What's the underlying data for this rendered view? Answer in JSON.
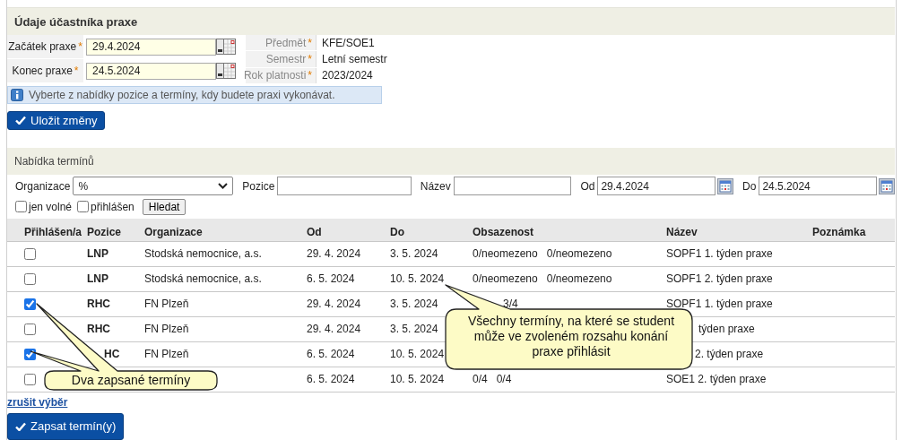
{
  "participant": {
    "title": "Údaje účastníka praxe",
    "dates": [
      {
        "label": "Začátek praxe",
        "required_mark": "*",
        "value": "29.4.2024"
      },
      {
        "label": "Konec praxe",
        "required_mark": "*",
        "value": "24.5.2024"
      }
    ],
    "details": [
      {
        "label": "Předmět",
        "required_mark": "*",
        "value": "KFE/SOE1"
      },
      {
        "label": "Semestr",
        "required_mark": "*",
        "value": "Letní semestr"
      },
      {
        "label": "Rok platnosti",
        "required_mark": "*",
        "value": "2023/2024"
      }
    ],
    "info": "Vyberte z nabídky pozice a termíny, kdy budete praxi vykonávat.",
    "save_button": "Uložit změny"
  },
  "offers": {
    "title": "Nabídka termínů",
    "filters": {
      "organization": {
        "label": "Organizace",
        "value": "%"
      },
      "position": {
        "label": "Pozice"
      },
      "name": {
        "label": "Název"
      },
      "from": {
        "label": "Od",
        "value": "29.4.2024"
      },
      "to": {
        "label": "Do",
        "value": "24.5.2024"
      },
      "options": [
        {
          "label": "jen volné",
          "checked": false
        },
        {
          "label": "přihlášen",
          "checked": false
        }
      ],
      "search_button": "Hledat"
    },
    "table": {
      "columns": [
        "Přihlášen/a",
        "Pozice",
        "Organizace",
        "Od",
        "Do",
        "Obsazenost",
        "Název",
        "Poznámka"
      ],
      "rows": [
        {
          "checked": false,
          "position": "LNP",
          "organization": "Stodská nemocnice, a.s.",
          "from": "29. 4. 2024",
          "to": "3. 5. 2024",
          "occupancy": "0/neomezeno   0/neomezeno",
          "name": "SOPF1 1. týden praxe"
        },
        {
          "checked": false,
          "position": "LNP",
          "organization": "Stodská nemocnice, a.s.",
          "from": "6. 5. 2024",
          "to": "10. 5. 2024",
          "occupancy": "0/neomezeno   0/neomezeno",
          "name": "SOPF1 2. týden praxe"
        },
        {
          "checked": true,
          "position": "RHC",
          "organization": "FN Plzeň",
          "from": "29. 4. 2024",
          "to": "3. 5. 2024",
          "occupancy": "3/4",
          "name": "SOPF1 1. týden praxe"
        },
        {
          "checked": false,
          "position": "RHC",
          "organization": "FN Plzeň",
          "from": "29. 4. 2024",
          "to": "3. 5. 2024",
          "name": "týden praxe"
        },
        {
          "checked": true,
          "position": "HC",
          "organization": "FN Plzeň",
          "from": "6. 5. 2024",
          "to": "10. 5. 2024",
          "name": "2. týden praxe"
        },
        {
          "checked": false,
          "from": "6. 5. 2024",
          "to": "10. 5. 2024",
          "occupancy": "0/4   0/4",
          "name": "SOE1 2. týden praxe"
        }
      ]
    },
    "clear_link": "zrušit výběr",
    "submit_button": "Zapsat termín(y)"
  },
  "callouts": [
    {
      "text": "Všechny termíny, na které se student může ve zvoleném rozsahu konání praxe přihlásit"
    },
    {
      "text": "Dva zapsané termíny"
    }
  ]
}
